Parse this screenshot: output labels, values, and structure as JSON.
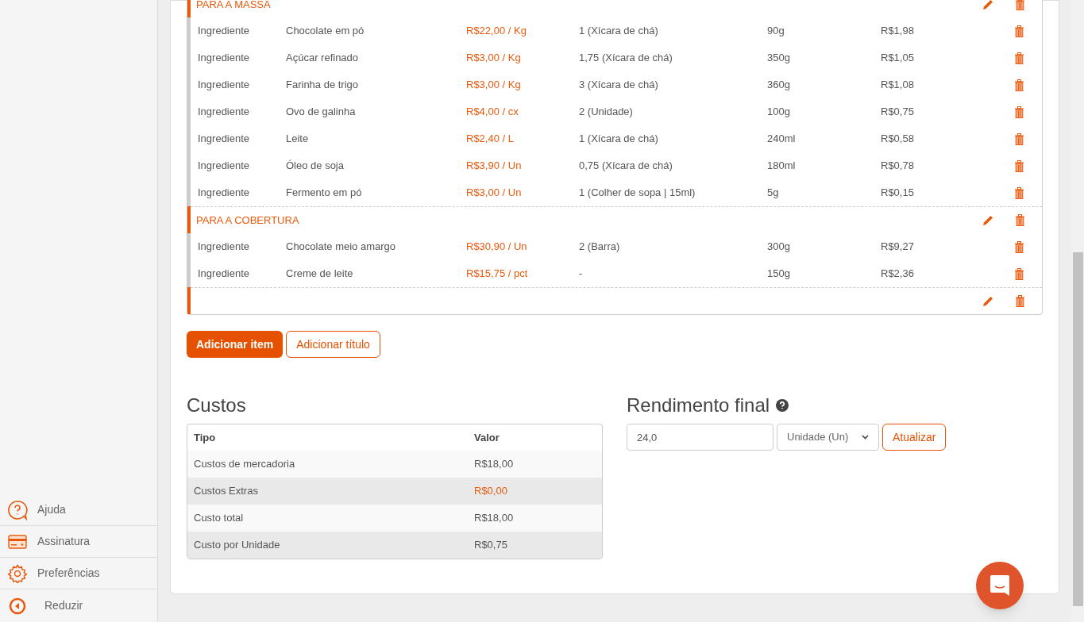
{
  "sidebar": {
    "items": [
      {
        "kind": "help",
        "label": "Ajuda"
      },
      {
        "kind": "card",
        "label": "Assinatura"
      },
      {
        "kind": "gear",
        "label": "Preferências"
      },
      {
        "kind": "collapse",
        "label": "Reduzir"
      }
    ]
  },
  "recipe_items": [
    {
      "kind": "title",
      "label": "PARA A MASSA"
    },
    {
      "kind": "item",
      "type": "Ingrediente",
      "name": "Chocolate em pó",
      "price": "R$22,00 / Kg",
      "quantity": "1 (Xícara de chá)",
      "weight": "90g",
      "cost": "R$1,98"
    },
    {
      "kind": "item",
      "type": "Ingrediente",
      "name": "Açúcar refinado",
      "price": "R$3,00 / Kg",
      "quantity": "1,75 (Xícara de chá)",
      "weight": "350g",
      "cost": "R$1,05"
    },
    {
      "kind": "item",
      "type": "Ingrediente",
      "name": "Farinha de trigo",
      "price": "R$3,00 / Kg",
      "quantity": "3 (Xícara de chá)",
      "weight": "360g",
      "cost": "R$1,08"
    },
    {
      "kind": "item",
      "type": "Ingrediente",
      "name": "Ovo de galinha",
      "price": "R$4,00 / cx",
      "quantity": "2 (Unidade)",
      "weight": "100g",
      "cost": "R$0,75"
    },
    {
      "kind": "item",
      "type": "Ingrediente",
      "name": "Leite",
      "price": "R$2,40 / L",
      "quantity": "1 (Xícara de chá)",
      "weight": "240ml",
      "cost": "R$0,58"
    },
    {
      "kind": "item",
      "type": "Ingrediente",
      "name": "Óleo de soja",
      "price": "R$3,90 / Un",
      "quantity": "0,75 (Xícara de chá)",
      "weight": "180ml",
      "cost": "R$0,78"
    },
    {
      "kind": "item",
      "type": "Ingrediente",
      "name": "Fermento em pó",
      "price": "R$3,00 / Un",
      "quantity": "1 (Colher de sopa | 15ml)",
      "weight": "5g",
      "cost": "R$0,15"
    },
    {
      "kind": "title",
      "label": "PARA A COBERTURA"
    },
    {
      "kind": "item",
      "type": "Ingrediente",
      "name": "Chocolate meio amargo",
      "price": "R$30,90 / Un",
      "quantity": "2 (Barra)",
      "weight": "300g",
      "cost": "R$9,27"
    },
    {
      "kind": "item",
      "type": "Ingrediente",
      "name": "Creme de leite",
      "price": "R$15,75 / pct",
      "quantity": "-",
      "weight": "150g",
      "cost": "R$2,36"
    },
    {
      "kind": "title"
    }
  ],
  "buttons": {
    "add_item": "Adicionar item",
    "add_title": "Adicionar título"
  },
  "costs": {
    "title": "Custos",
    "columns": [
      "Tipo",
      "Valor"
    ],
    "rows": [
      {
        "type": "Custos de mercadoria",
        "value": "R$18,00",
        "link": false
      },
      {
        "type": "Custos Extras",
        "value": "R$0,00",
        "link": true
      },
      {
        "type": "Custo total",
        "value": "R$18,00",
        "link": false
      },
      {
        "type": "Custo por Unidade",
        "value": "R$0,75",
        "link": false
      }
    ]
  },
  "yield": {
    "title": "Rendimento final",
    "value": "24,0",
    "unit": "Unidade (Un)",
    "button": "Atualizar"
  }
}
